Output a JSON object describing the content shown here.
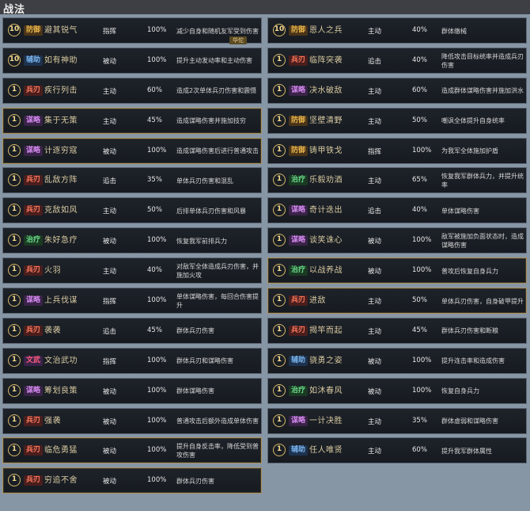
{
  "header": {
    "title": "战法"
  },
  "left": [
    {
      "level": "10",
      "tag": "防御",
      "tag_type": "fang",
      "name": "避其锐气",
      "type": "指挥",
      "rate": "100%",
      "desc": "减少自身和随机友军受到伤害",
      "badge": "华佗",
      "gold": false
    },
    {
      "level": "10",
      "tag": "辅助",
      "tag_type": "fu",
      "name": "如有神助",
      "type": "被动",
      "rate": "100%",
      "desc": "提升主动发动率和主动伤害",
      "gold": false
    },
    {
      "level": "1",
      "tag": "兵刃",
      "tag_type": "bing",
      "name": "疾行列击",
      "type": "主动",
      "rate": "60%",
      "desc": "造成2次单体兵刃伤害和震慑",
      "gold": false
    },
    {
      "level": "1",
      "tag": "谋略",
      "tag_type": "mou",
      "name": "集于无策",
      "type": "主动",
      "rate": "45%",
      "desc": "造成谋略伤害并施加技穷",
      "gold": true
    },
    {
      "level": "1",
      "tag": "谋略",
      "tag_type": "mou",
      "name": "计逐穷寇",
      "type": "被动",
      "rate": "100%",
      "desc": "造成谋略伤害后进行普通攻击",
      "gold": true
    },
    {
      "level": "1",
      "tag": "兵刃",
      "tag_type": "bing",
      "name": "乱敌方阵",
      "type": "追击",
      "rate": "35%",
      "desc": "单体兵刃伤害和混乱",
      "gold": false
    },
    {
      "level": "1",
      "tag": "兵刃",
      "tag_type": "bing",
      "name": "克敌如风",
      "type": "主动",
      "rate": "50%",
      "desc": "后排单体兵刃伤害和风暴",
      "gold": false
    },
    {
      "level": "1",
      "tag": "治疗",
      "tag_type": "zhi",
      "name": "朱好急疗",
      "type": "被动",
      "rate": "100%",
      "desc": "恢复我军前排兵力",
      "gold": false
    },
    {
      "level": "1",
      "tag": "兵刃",
      "tag_type": "bing",
      "name": "火羽",
      "type": "主动",
      "rate": "40%",
      "desc": "对敌军全体造成兵刃伤害，并施加火攻",
      "gold": false
    },
    {
      "level": "1",
      "tag": "谋略",
      "tag_type": "mou",
      "name": "上兵伐谋",
      "type": "指挥",
      "rate": "100%",
      "desc": "单体谋略伤害，每回合伤害提升",
      "gold": false
    },
    {
      "level": "1",
      "tag": "兵刃",
      "tag_type": "bing",
      "name": "袭袭",
      "type": "追击",
      "rate": "45%",
      "desc": "群体兵刃伤害",
      "gold": false
    },
    {
      "level": "1",
      "tag": "文武",
      "tag_type": "wen",
      "name": "文治武功",
      "type": "指挥",
      "rate": "100%",
      "desc": "群体兵刃和谋略伤害",
      "gold": false
    },
    {
      "level": "1",
      "tag": "谋略",
      "tag_type": "mou",
      "name": "筹划良策",
      "type": "被动",
      "rate": "100%",
      "desc": "群体谋略伤害",
      "gold": false
    },
    {
      "level": "1",
      "tag": "兵刃",
      "tag_type": "bing",
      "name": "强袭",
      "type": "被动",
      "rate": "100%",
      "desc": "普通攻击后额外造成单体伤害",
      "gold": false
    },
    {
      "level": "1",
      "tag": "兵刃",
      "tag_type": "bing",
      "name": "临危勇猛",
      "type": "被动",
      "rate": "100%",
      "desc": "提升自身反击率，降低受到普攻伤害",
      "gold": true
    },
    {
      "level": "1",
      "tag": "兵刃",
      "tag_type": "bing",
      "name": "穷追不舍",
      "type": "被动",
      "rate": "100%",
      "desc": "群体兵刃伤害",
      "gold": true
    }
  ],
  "right": [
    {
      "level": "10",
      "tag": "防御",
      "tag_type": "fang",
      "name": "恩人之兵",
      "type": "主动",
      "rate": "40%",
      "desc": "群体缴械",
      "gold": false
    },
    {
      "level": "1",
      "tag": "兵刃",
      "tag_type": "bing",
      "name": "临阵突袭",
      "type": "追击",
      "rate": "40%",
      "desc": "降低攻击目标统率并造成兵刃伤害",
      "gold": false
    },
    {
      "level": "1",
      "tag": "谋略",
      "tag_type": "mou",
      "name": "决水破敌",
      "type": "主动",
      "rate": "60%",
      "desc": "造成群体谋略伤害并施加洪水",
      "gold": false
    },
    {
      "level": "1",
      "tag": "防御",
      "tag_type": "fang",
      "name": "坚壁清野",
      "type": "主动",
      "rate": "50%",
      "desc": "嘲讽全体提升自身统率",
      "gold": false
    },
    {
      "level": "1",
      "tag": "防御",
      "tag_type": "fang",
      "name": "铸甲铁戈",
      "type": "指挥",
      "rate": "100%",
      "desc": "为我军全体施加护盾",
      "gold": false
    },
    {
      "level": "1",
      "tag": "治疗",
      "tag_type": "zhi",
      "name": "乐毅劝酒",
      "type": "主动",
      "rate": "65%",
      "desc": "恢复我军群体兵力，并提升统率",
      "gold": false
    },
    {
      "level": "1",
      "tag": "谋略",
      "tag_type": "mou",
      "name": "奇计迭出",
      "type": "追击",
      "rate": "40%",
      "desc": "单体谋略伤害",
      "gold": false
    },
    {
      "level": "1",
      "tag": "谋略",
      "tag_type": "mou",
      "name": "谈笑诛心",
      "type": "被动",
      "rate": "100%",
      "desc": "敌军被施加负面状态时，造成谋略伤害",
      "gold": false
    },
    {
      "level": "1",
      "tag": "治疗",
      "tag_type": "zhi",
      "name": "以战养战",
      "type": "被动",
      "rate": "100%",
      "desc": "普攻后恢复自身兵力",
      "gold": true
    },
    {
      "level": "1",
      "tag": "兵刃",
      "tag_type": "bing",
      "name": "进敌",
      "type": "主动",
      "rate": "50%",
      "desc": "单体兵刃伤害，自身破甲提升",
      "gold": true
    },
    {
      "level": "1",
      "tag": "兵刃",
      "tag_type": "bing",
      "name": "揭竿而起",
      "type": "主动",
      "rate": "45%",
      "desc": "群体兵刃伤害和断粮",
      "gold": false
    },
    {
      "level": "1",
      "tag": "辅助",
      "tag_type": "fu",
      "name": "骁勇之姿",
      "type": "被动",
      "rate": "100%",
      "desc": "提升连击率和造成伤害",
      "gold": false
    },
    {
      "level": "1",
      "tag": "治疗",
      "tag_type": "zhi",
      "name": "如沐春风",
      "type": "被动",
      "rate": "100%",
      "desc": "恢复自身兵力",
      "gold": false
    },
    {
      "level": "1",
      "tag": "谋略",
      "tag_type": "mou",
      "name": "一计决胜",
      "type": "主动",
      "rate": "35%",
      "desc": "群体虚弱和谋略伤害",
      "gold": false
    },
    {
      "level": "1",
      "tag": "辅助",
      "tag_type": "fu",
      "name": "任人唯贤",
      "type": "主动",
      "rate": "60%",
      "desc": "提升我军群体属性",
      "gold": false
    }
  ]
}
